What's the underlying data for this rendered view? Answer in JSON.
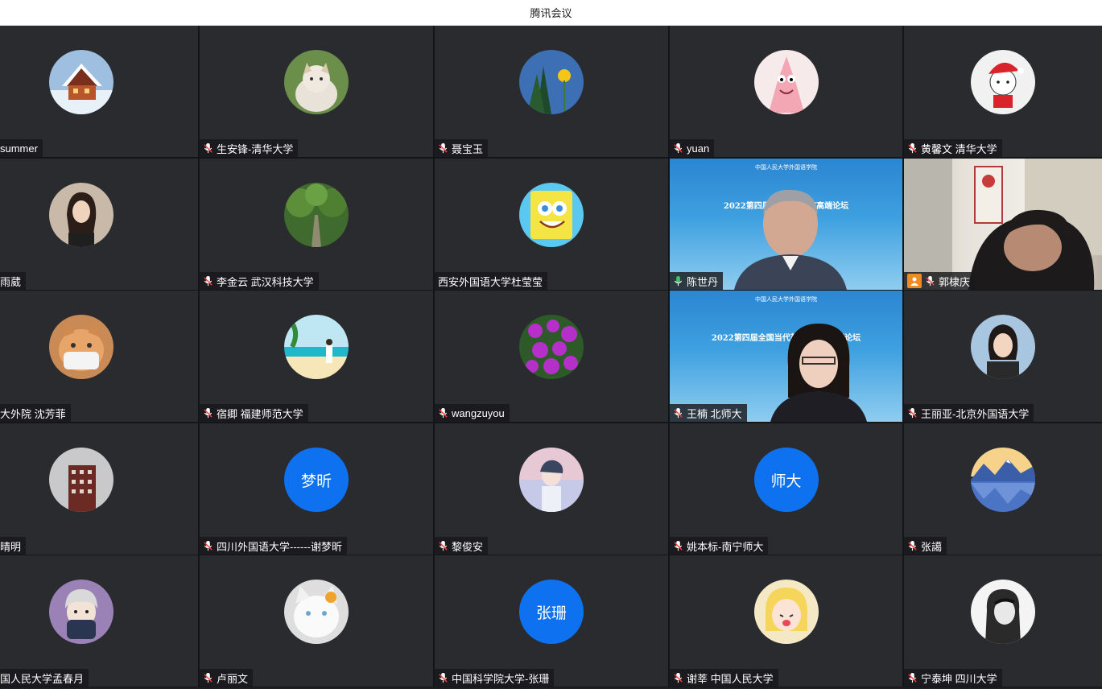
{
  "window": {
    "title": "腾讯会议"
  },
  "participants": [
    {
      "name": "summer",
      "avatar": "winter-cabin-avatar",
      "mic": false
    },
    {
      "name": "生安锋-清华大学",
      "avatar": "cat-avatar",
      "mic": true
    },
    {
      "name": "聂宝玉",
      "avatar": "sunflower-tree-avatar",
      "mic": true
    },
    {
      "name": "yuan",
      "avatar": "patrick-star-avatar",
      "mic": true
    },
    {
      "name": "黄馨文 清华大学",
      "avatar": "christmas-girl-avatar",
      "mic": true
    },
    {
      "name": "雨葳",
      "avatar": "woman-photo-avatar",
      "mic": false
    },
    {
      "name": "李金云 武汉科技大学",
      "avatar": "tree-avenue-avatar",
      "mic": true
    },
    {
      "name": "西安外国语大学杜莹莹",
      "avatar": "spongebob-avatar",
      "mic": false
    },
    {
      "name": "陈世丹",
      "avatar": "video-speaker",
      "mic": true,
      "banner_text": "2022第四届 ··· 前沿研究高端论坛",
      "banner_logo": "中国人民大学外国语学院"
    },
    {
      "name": "郭棣庆",
      "avatar": "video-room",
      "mic": true
    },
    {
      "name": "大外院 沈芳菲",
      "avatar": "masked-cat-avatar",
      "mic": false
    },
    {
      "name": "宿卿 福建师范大学",
      "avatar": "beach-girl-avatar",
      "mic": true
    },
    {
      "name": "wangzuyou",
      "avatar": "purple-flowers-avatar",
      "mic": true
    },
    {
      "name": "王楠 北师大",
      "avatar": "video-speaker-woman",
      "mic": true,
      "banner_text": "2022第四届全国当代英 ··· 研究高端论坛",
      "banner_logo": "中国人民大学外国语学院"
    },
    {
      "name": "王丽亚-北京外国语大学",
      "avatar": "woman-portrait-avatar",
      "mic": true
    },
    {
      "name": "晴明",
      "avatar": "building-avatar",
      "mic": false
    },
    {
      "name": "四川外国语大学------谢梦昕",
      "avatar": "text",
      "avatar_text": "梦昕",
      "mic": true
    },
    {
      "name": "黎俊安",
      "avatar": "anime-boy-avatar",
      "mic": true
    },
    {
      "name": "姚本标-南宁师大",
      "avatar": "text",
      "avatar_text": "师大",
      "mic": true
    },
    {
      "name": "张譪",
      "avatar": "mountain-lake-avatar",
      "mic": true
    },
    {
      "name": "国人民大学孟春月",
      "avatar": "cartoon-boy-avatar",
      "mic": false
    },
    {
      "name": "卢丽文",
      "avatar": "white-cat-avatar",
      "mic": true
    },
    {
      "name": "中国科学院大学-张珊",
      "avatar": "text",
      "avatar_text": "张珊",
      "mic": true
    },
    {
      "name": "谢莘 中国人民大学",
      "avatar": "sailor-moon-avatar",
      "mic": true
    },
    {
      "name": "宁泰坤 四川大学",
      "avatar": "sketch-man-avatar",
      "mic": true
    }
  ]
}
